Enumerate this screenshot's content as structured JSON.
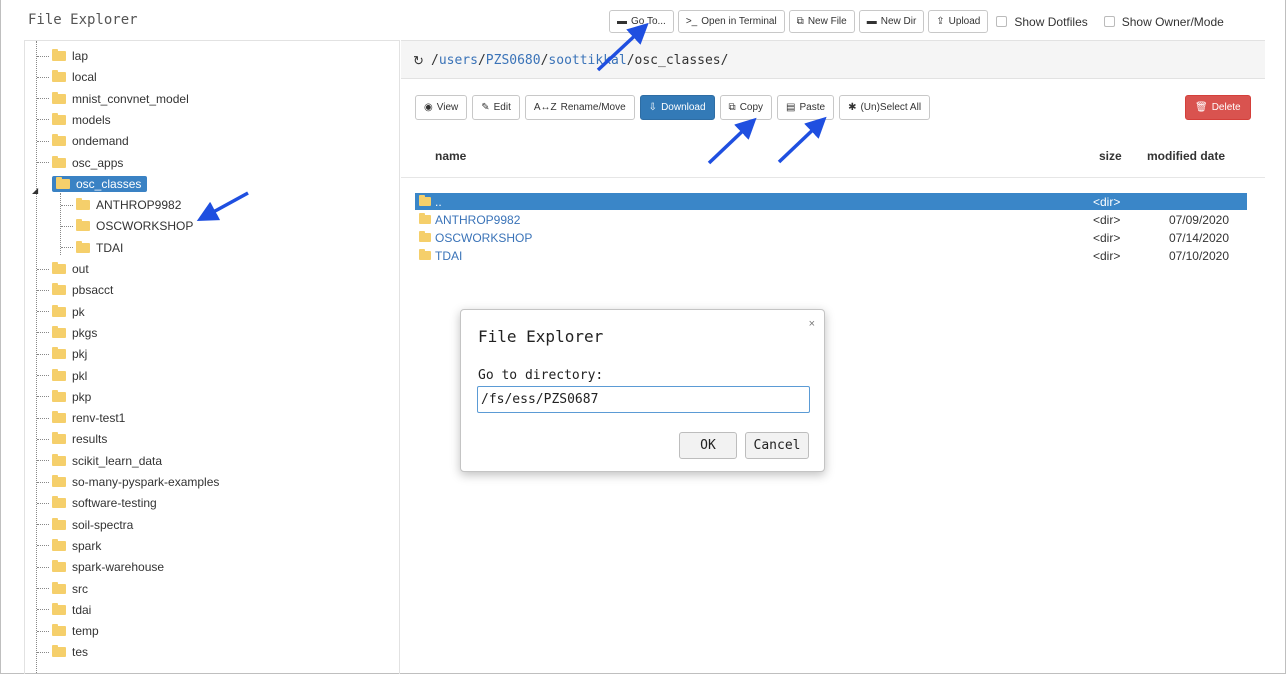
{
  "app": {
    "title": "File Explorer"
  },
  "toolbar": {
    "go_to": "Go To...",
    "open_terminal": "Open in Terminal",
    "new_file": "New File",
    "new_dir": "New Dir",
    "upload": "Upload",
    "show_dotfiles": "Show Dotfiles",
    "show_owner_mode": "Show Owner/Mode"
  },
  "tree": {
    "items_top": [
      "lap",
      "local",
      "mnist_convnet_model",
      "models",
      "ondemand",
      "osc_apps"
    ],
    "selected": "osc_classes",
    "children": [
      "ANTHROP9982",
      "OSCWORKSHOP",
      "TDAI"
    ],
    "items_bottom": [
      "out",
      "pbsacct",
      "pk",
      "pkgs",
      "pkj",
      "pkl",
      "pkp",
      "renv-test1",
      "results",
      "scikit_learn_data",
      "so-many-pyspark-examples",
      "software-testing",
      "soil-spectra",
      "spark",
      "spark-warehouse",
      "src",
      "tdai",
      "temp",
      "tes"
    ]
  },
  "path": {
    "root": "/",
    "segments": [
      "users",
      "PZS0680",
      "soottikkal"
    ],
    "current": "osc_classes/"
  },
  "actions": {
    "view": "View",
    "edit": "Edit",
    "rename": "Rename/Move",
    "download": "Download",
    "copy": "Copy",
    "paste": "Paste",
    "select_all": "(Un)Select All",
    "delete": "Delete"
  },
  "table": {
    "headers": {
      "name": "name",
      "size": "size",
      "modified": "modified date"
    },
    "rows": [
      {
        "name": "..",
        "size": "<dir>",
        "date": ""
      },
      {
        "name": "ANTHROP9982",
        "size": "<dir>",
        "date": "07/09/2020"
      },
      {
        "name": "OSCWORKSHOP",
        "size": "<dir>",
        "date": "07/14/2020"
      },
      {
        "name": "TDAI",
        "size": "<dir>",
        "date": "07/10/2020"
      }
    ]
  },
  "modal": {
    "title": "File Explorer",
    "close": "×",
    "label": "Go to directory:",
    "value": "/fs/ess/PZS0687",
    "ok": "OK",
    "cancel": "Cancel"
  },
  "colors": {
    "primary": "#337ab7",
    "danger": "#d9534f",
    "folder": "#f5cf6b",
    "selection": "#3a86c8",
    "annotation_arrow": "#1f4fe0"
  }
}
